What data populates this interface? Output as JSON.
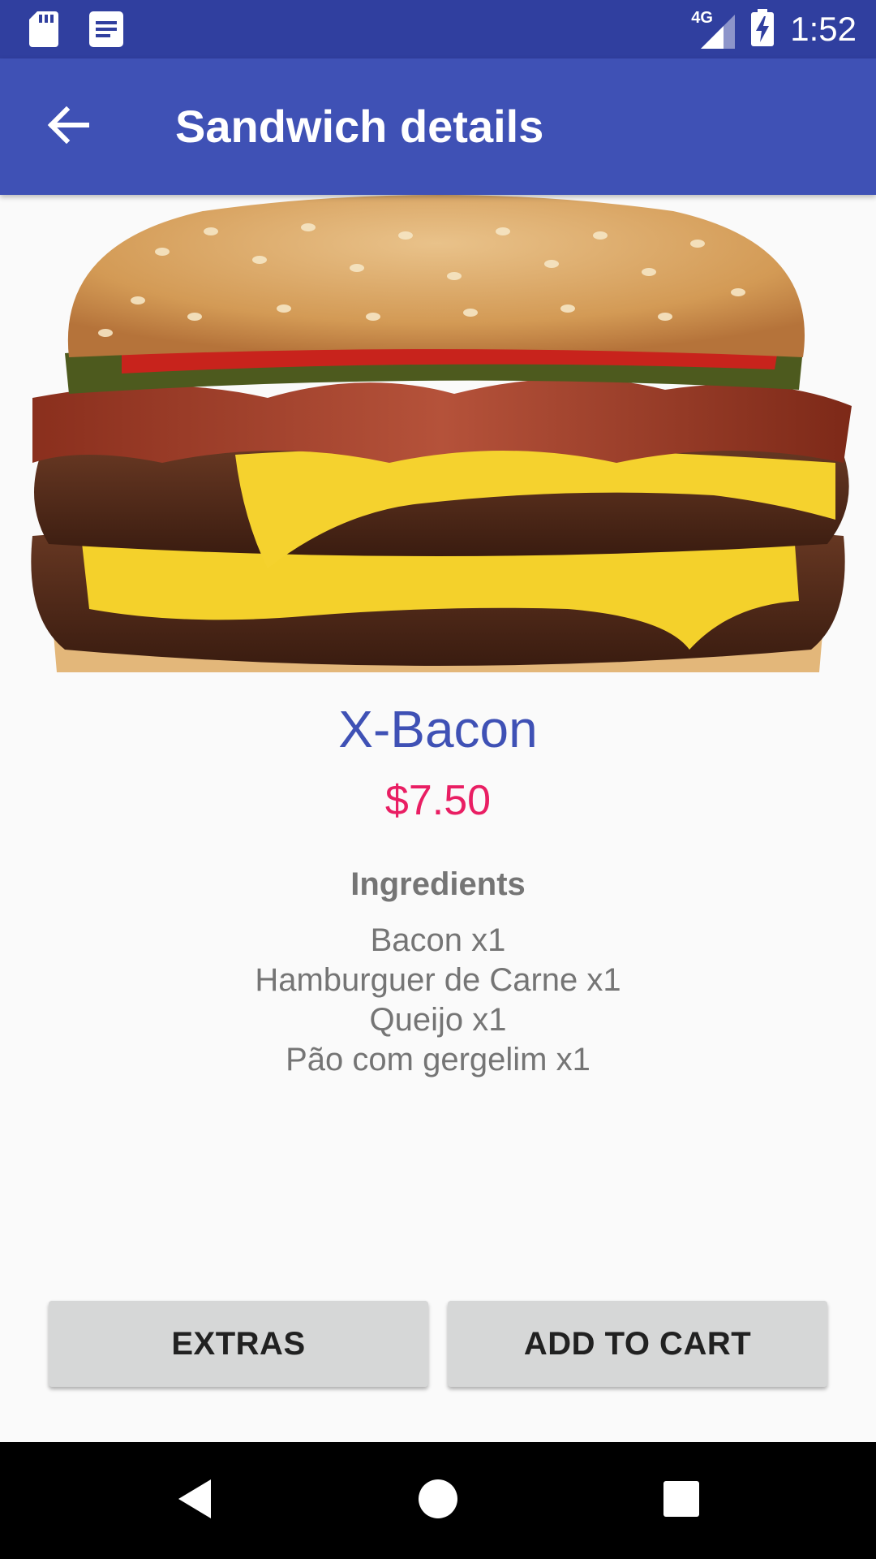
{
  "status_bar": {
    "time": "1:52",
    "network": "4G",
    "icons": [
      "sd-card-icon",
      "notification-doc-icon",
      "signal-icon",
      "battery-charging-icon"
    ]
  },
  "app_bar": {
    "title": "Sandwich details",
    "back_icon": "arrow-back-icon"
  },
  "sandwich": {
    "name": "X-Bacon",
    "price": "$7.50",
    "image_alt": "bacon cheeseburger photo",
    "ingredients_title": "Ingredients",
    "ingredients": [
      "Bacon x1",
      "Hamburguer de Carne x1",
      "Queijo x1",
      "Pão com gergelim x1"
    ]
  },
  "actions": {
    "extras_label": "EXTRAS",
    "add_to_cart_label": "ADD TO CART"
  },
  "nav_bar": {
    "icons": [
      "nav-back-icon",
      "nav-home-icon",
      "nav-recents-icon"
    ]
  },
  "colors": {
    "status_bar": "#303f9f",
    "app_bar": "#3f51b5",
    "name": "#3f51b5",
    "price": "#e91e63",
    "button_bg": "#d6d7d7",
    "ingredient_text": "#757575"
  }
}
